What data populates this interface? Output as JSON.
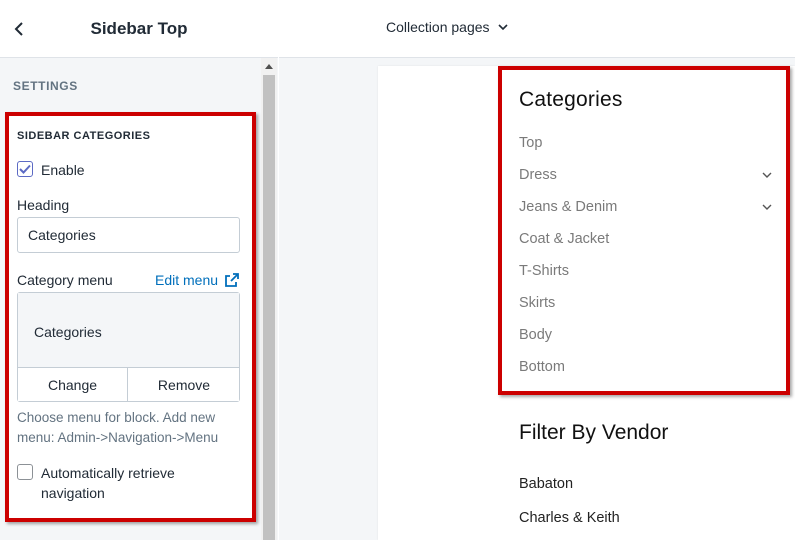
{
  "panel": {
    "title": "Sidebar Top",
    "settings_label": "SETTINGS"
  },
  "section": {
    "heading": "SIDEBAR CATEGORIES",
    "enable_label": "Enable",
    "enable_checked": true,
    "heading_label": "Heading",
    "heading_value": "Categories",
    "category_menu_label": "Category menu",
    "edit_menu_link": "Edit menu",
    "selected_menu": "Categories",
    "change_button": "Change",
    "remove_button": "Remove",
    "help_text": "Choose menu for block. Add new menu: Admin->Navigation->Menu",
    "auto_retrieve_label": "Automatically retrieve navigation",
    "auto_retrieve_checked": false
  },
  "topbar": {
    "page_selector": "Collection pages"
  },
  "preview": {
    "categories_title": "Categories",
    "categories": [
      {
        "label": "Top",
        "has_children": false
      },
      {
        "label": "Dress",
        "has_children": true
      },
      {
        "label": "Jeans & Denim",
        "has_children": true
      },
      {
        "label": "Coat & Jacket",
        "has_children": false
      },
      {
        "label": "T-Shirts",
        "has_children": false
      },
      {
        "label": "Skirts",
        "has_children": false
      },
      {
        "label": "Body",
        "has_children": false
      },
      {
        "label": "Bottom",
        "has_children": false
      }
    ],
    "vendor_title": "Filter By Vendor",
    "vendors": [
      "Babaton",
      "Charles & Keith"
    ]
  },
  "colors": {
    "highlight_red": "#cc0000",
    "link_blue": "#006fbb",
    "checkbox_accent": "#5c6ac4"
  },
  "icons": {
    "back": "chevron-left-icon",
    "scroll_up": "scroll-up-arrow-icon",
    "external": "external-link-icon",
    "dropdown": "chevron-down-icon",
    "checkmark": "checkmark-icon"
  }
}
